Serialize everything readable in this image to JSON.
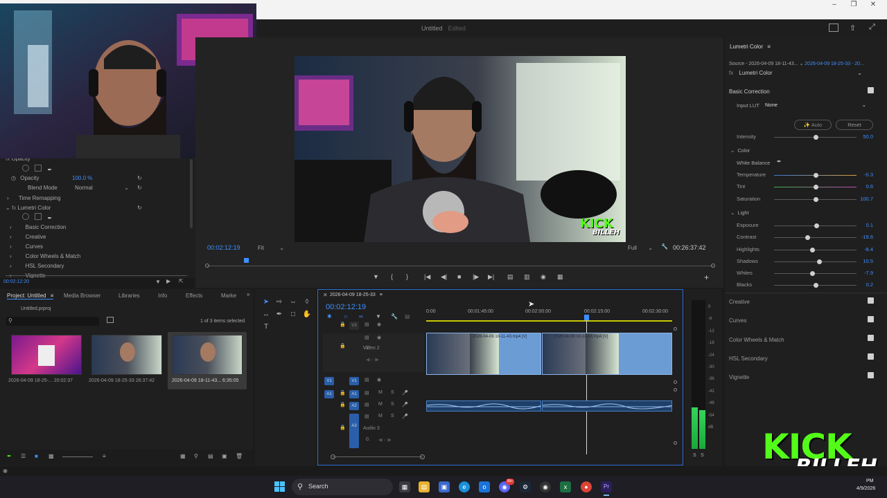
{
  "app": {
    "project_title": "Untitled",
    "edited_label": "Edited",
    "source_name_fragment": "8-25-33"
  },
  "effect_controls": {
    "opacity_header": "Opacity",
    "opacity_label": "Opacity",
    "opacity_value": "100.0 %",
    "blend_mode_label": "Blend Mode",
    "blend_mode_value": "Normal",
    "time_remapping": "Time Remapping",
    "lumetri_label": "Lumetri Color",
    "sub_items": [
      "Basic Correction",
      "Creative",
      "Curves",
      "Color Wheels & Match",
      "HSL Secondary",
      "Vignette"
    ],
    "timecode": "00:02:12:20"
  },
  "program_monitor": {
    "timecode": "00:02:12:19",
    "fit_label": "Fit",
    "quality_label": "Full",
    "duration": "00:26:37:42",
    "watermark_top": "KICK",
    "watermark_bottom": "BILLEH"
  },
  "project_panel": {
    "tabs": [
      "Project: Untitled",
      "Media Browser",
      "Libraries",
      "Info",
      "Effects",
      "Marke"
    ],
    "file_name": "Untitled.prproj",
    "search_placeholder": "",
    "selection_status": "1 of 3 items selected",
    "items": [
      {
        "name": "2026-04-09 18-25-...",
        "duration": "20:02:37"
      },
      {
        "name": "2026-04-09 18-25-33",
        "duration": "26:37:42"
      },
      {
        "name": "2026-04-09 18-11-43...",
        "duration": "6:35:05"
      }
    ]
  },
  "timeline": {
    "sequence_name": "2026-04-09 18-25-33",
    "timecode": "00:02:12:19",
    "ruler_labels": [
      "0:00",
      "00:01:45:00",
      "00:02:00:00",
      "00:02:15:00",
      "00:02:30:00"
    ],
    "tracks": {
      "v3": "V3",
      "v2": "V2",
      "video2_name": "Video 2",
      "v1": "V1",
      "a1": "A1",
      "a2": "A2",
      "a3": "A3",
      "audio3_name": "Audio 3",
      "m": "M",
      "s": "S",
      "zero": "0."
    },
    "clips": [
      {
        "label": "2026-04-09 18-11-43.mp4 [V]"
      },
      {
        "label": "2026-04-09 18-11-43.mp4 [V]"
      }
    ]
  },
  "meter": {
    "labels": [
      "0",
      "-6",
      "-12",
      "-18",
      "-24",
      "-30",
      "-36",
      "-42",
      "-48",
      "-54",
      "dB"
    ],
    "solo": [
      "S",
      "S"
    ],
    "level_left": 0.28,
    "level_right": 0.26
  },
  "lumetri": {
    "panel_title": "Lumetri Color",
    "source_label": "Source - 2026-04-09 18-11-43...",
    "target_label": "2026-04-09 18-25-33 - 20...",
    "fx_label": "Lumetri Color",
    "basic_correction": "Basic Correction",
    "input_lut_label": "Input LUT",
    "input_lut_value": "None",
    "auto_label": "Auto",
    "reset_label": "Reset",
    "color_section": "Color",
    "white_balance": "White Balance",
    "light_section": "Light",
    "sliders": [
      {
        "label": "Intensity",
        "value": "50.0",
        "pos": 0.5
      },
      {
        "label": "Temperature",
        "value": "-0.3",
        "pos": 0.5
      },
      {
        "label": "Tint",
        "value": "0.6",
        "pos": 0.5
      },
      {
        "label": "Saturation",
        "value": "100.7",
        "pos": 0.5
      },
      {
        "label": "Exposure",
        "value": "0.1",
        "pos": 0.51
      },
      {
        "label": "Contrast",
        "value": "-19.6",
        "pos": 0.4
      },
      {
        "label": "Highlights",
        "value": "-8.4",
        "pos": 0.46
      },
      {
        "label": "Shadows",
        "value": "10.5",
        "pos": 0.55
      },
      {
        "label": "Whites",
        "value": "-7.9",
        "pos": 0.46
      },
      {
        "label": "Blacks",
        "value": "0.2",
        "pos": 0.5
      }
    ],
    "sections": [
      "Creative",
      "Curves",
      "Color Wheels & Match",
      "HSL Secondary",
      "Vignette"
    ]
  },
  "taskbar": {
    "search_label": "Search",
    "clock_time": "PM",
    "clock_date": "4/9/2026",
    "notification_badge": "99+"
  },
  "colors": {
    "accent": "#3f8fff",
    "clip_blue": "#6c9cd4",
    "kick_green": "#53fc18"
  }
}
